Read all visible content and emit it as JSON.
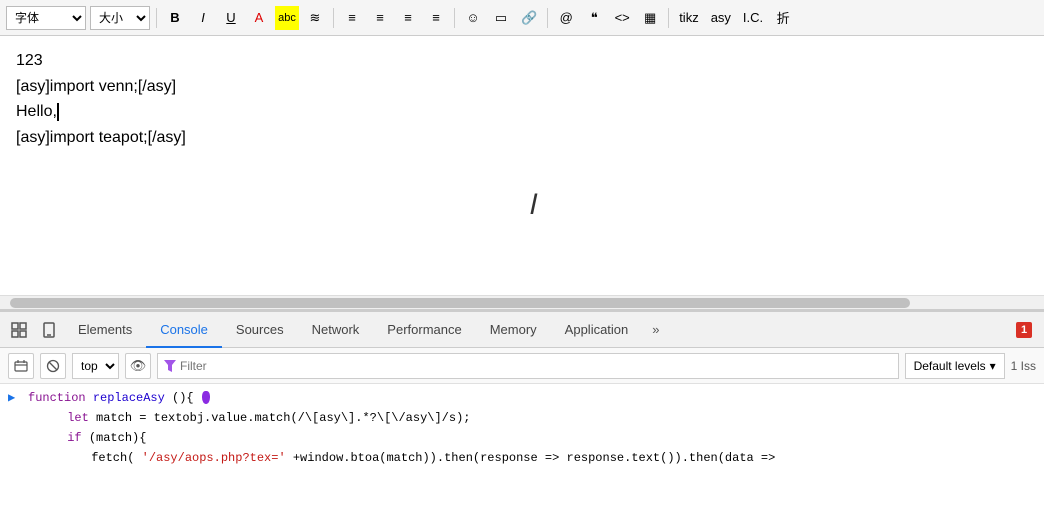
{
  "toolbar": {
    "font_label": "字体",
    "size_label": "大小",
    "bold_label": "B",
    "italic_label": "I",
    "underline_label": "U",
    "color_label": "A",
    "highlight_label": "abc",
    "eraser_label": "≋",
    "align_left": "≡",
    "align_center": "≡",
    "align_right": "≡",
    "align_justify": "≡",
    "emoji_label": "☺",
    "image_label": "▭",
    "link_label": "🔗",
    "at_label": "@",
    "quote_label": "❝",
    "code_label": "<>",
    "table_label": "▦",
    "tikz_label": "tikz",
    "asy_label": "asy",
    "ic_label": "I.C.",
    "fold_label": "折"
  },
  "editor": {
    "line1": "123",
    "line2": "[asy]import venn;[/asy]",
    "line3": "Hello,",
    "line4": "[asy]import teapot;[/asy]"
  },
  "devtools": {
    "tabs": [
      {
        "id": "elements",
        "label": "Elements"
      },
      {
        "id": "console",
        "label": "Console"
      },
      {
        "id": "sources",
        "label": "Sources"
      },
      {
        "id": "network",
        "label": "Network"
      },
      {
        "id": "performance",
        "label": "Performance"
      },
      {
        "id": "memory",
        "label": "Memory"
      },
      {
        "id": "application",
        "label": "Application"
      },
      {
        "id": "more",
        "label": "»"
      }
    ],
    "active_tab": "console",
    "error_count": "1",
    "error_label": "1",
    "icon_inspect": "⬚",
    "icon_device": "□",
    "toolbar": {
      "icon_panel": "⊞",
      "icon_block": "⊘",
      "level_select": "top",
      "icon_eye": "👁",
      "filter_placeholder": "Filter",
      "filter_icon": "⬡",
      "default_levels": "Default levels",
      "issues_label": "1 Iss"
    },
    "console_lines": [
      {
        "arrow": "▶",
        "code": "function replaceAsy(){"
      },
      {
        "indent": "  ",
        "code": "let match = textobj.value.match(/\\[asy\\].*?\\[\\/asy\\]/s);"
      },
      {
        "indent": "  ",
        "code": "if(match){"
      },
      {
        "indent": "    ",
        "code": "fetch('/asy/aops.php?tex='+window.btoa(match)).then(response => response.text()).then(data =>"
      }
    ]
  }
}
